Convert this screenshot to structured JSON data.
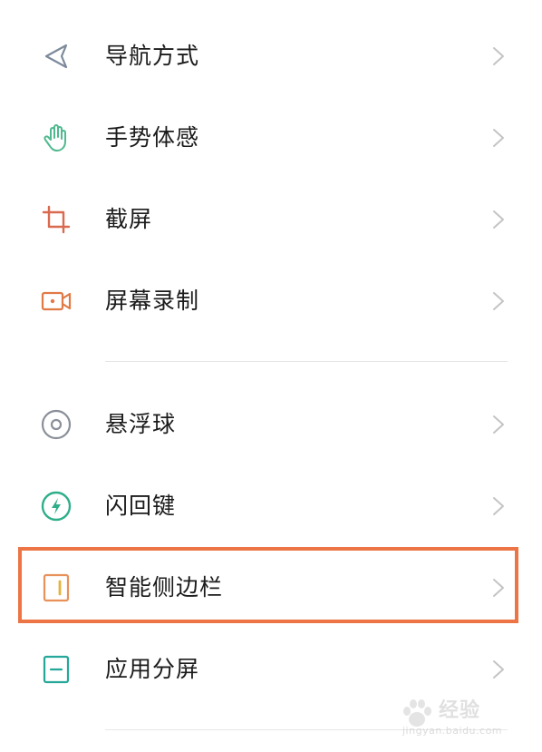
{
  "settings_list": {
    "items": [
      {
        "label": "导航方式",
        "icon": "navigation-arrow-icon",
        "icon_color": "#7d8a9b"
      },
      {
        "label": "手势体感",
        "icon": "hand-gesture-icon",
        "icon_color": "#4fb98f"
      },
      {
        "label": "截屏",
        "icon": "crop-icon",
        "icon_color": "#d96a4f"
      },
      {
        "label": "屏幕录制",
        "icon": "screen-record-icon",
        "icon_color": "#e07a45"
      },
      {
        "label": "悬浮球",
        "icon": "floating-ball-icon",
        "icon_color": "#8a8f99"
      },
      {
        "label": "闪回键",
        "icon": "flash-back-icon",
        "icon_color": "#2fae8a"
      },
      {
        "label": "智能侧边栏",
        "icon": "smart-sidebar-icon",
        "icon_color": "#e8915a",
        "highlighted": true
      },
      {
        "label": "应用分屏",
        "icon": "split-screen-icon",
        "icon_color": "#25a79a"
      }
    ]
  },
  "highlight_color": "#ec7445",
  "watermark": {
    "text": "经验",
    "sub": "jingyan.baidu.com"
  }
}
